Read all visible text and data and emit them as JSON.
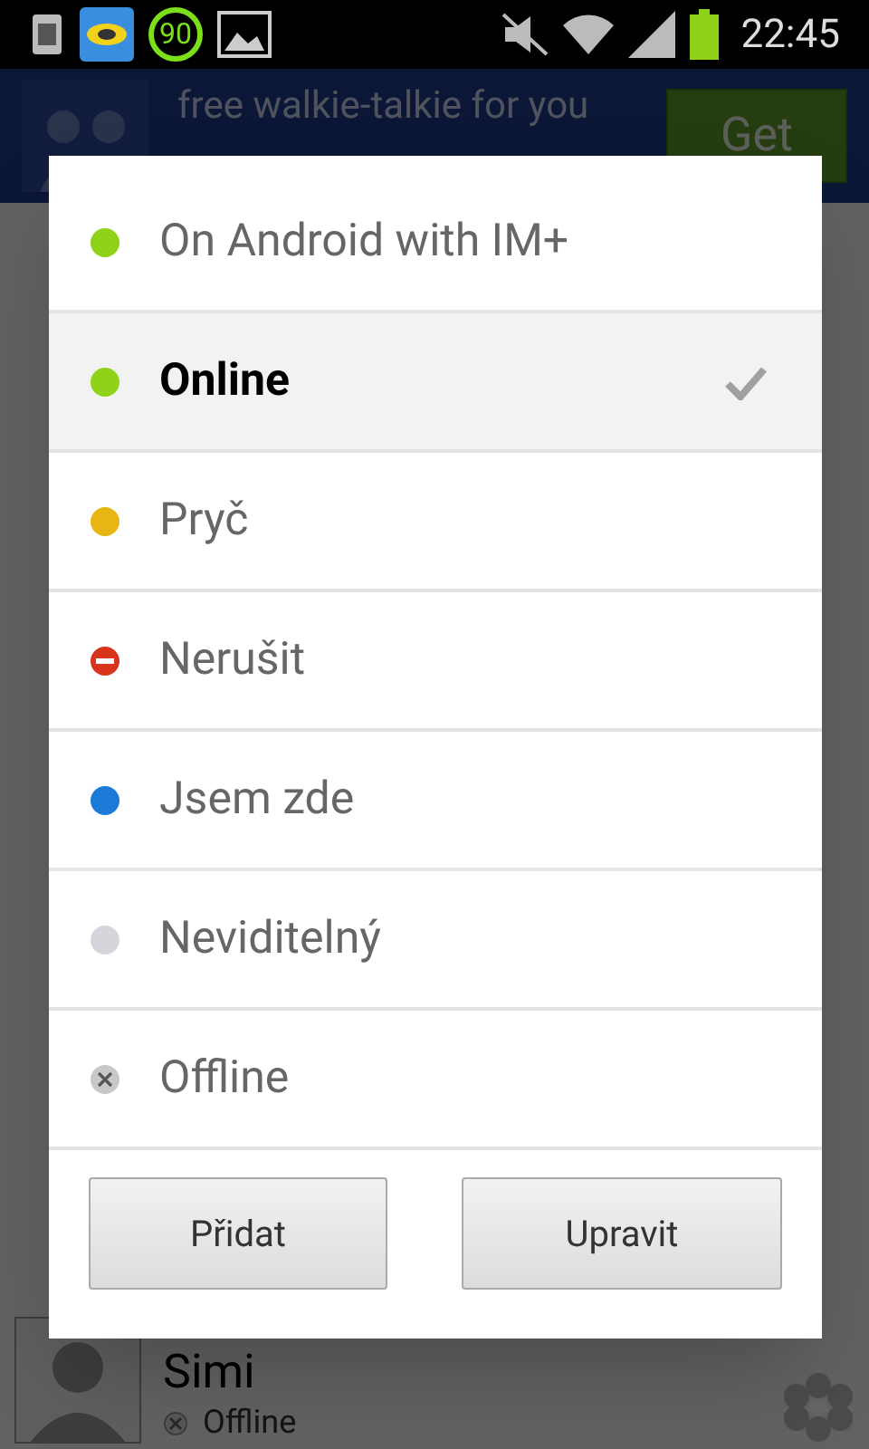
{
  "status_bar": {
    "time": "22:45",
    "notification_badge": "90"
  },
  "ad_banner": {
    "text": "free walkie-talkie for you",
    "button": "Get"
  },
  "contact": {
    "name": "Simi",
    "status": "Offline"
  },
  "status_dialog": {
    "options": [
      {
        "label": "On Android with IM+",
        "kind": "dot",
        "color": "#8fd219",
        "selected": false
      },
      {
        "label": "Online",
        "kind": "dot",
        "color": "#8fd219",
        "selected": true
      },
      {
        "label": "Pryč",
        "kind": "dot",
        "color": "#e8b612",
        "selected": false
      },
      {
        "label": "Nerušit",
        "kind": "blocked",
        "color": "#d8341c",
        "selected": false
      },
      {
        "label": "Jsem zde",
        "kind": "dot",
        "color": "#1c7ad8",
        "selected": false
      },
      {
        "label": "Neviditelný",
        "kind": "dot",
        "color": "#d4d6dc",
        "selected": false
      },
      {
        "label": "Offline",
        "kind": "offline",
        "color": "#c8c8c8",
        "selected": false
      }
    ],
    "buttons": [
      "Přidat",
      "Upravit"
    ]
  }
}
